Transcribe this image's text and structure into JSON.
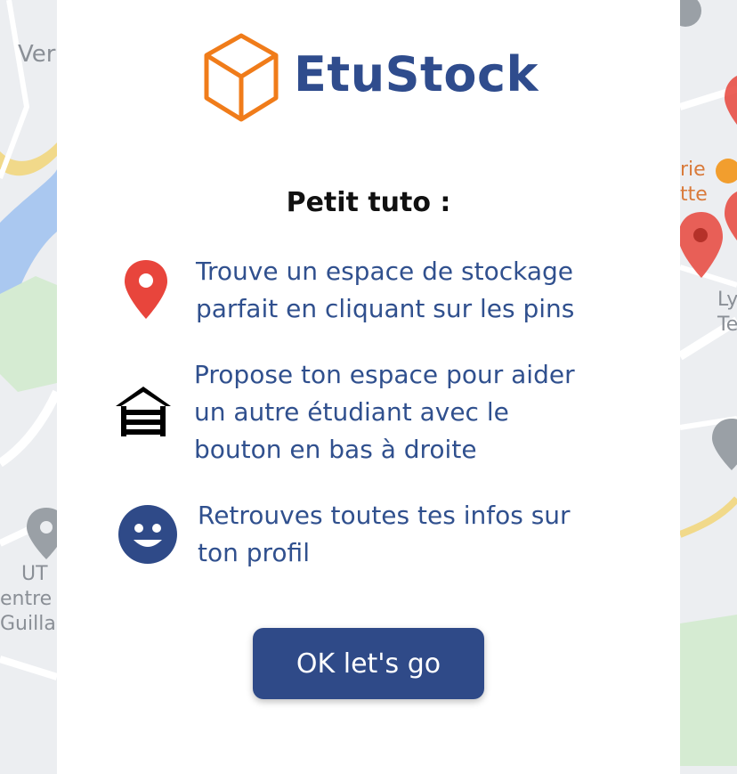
{
  "app": {
    "brand_name": "EtuStock",
    "brand_color": "#2f4c8d",
    "logo_color": "#f07c1a"
  },
  "tutorial": {
    "title": "Petit tuto :",
    "steps": [
      {
        "icon": "location-pin-icon",
        "icon_color": "#e8453c",
        "line1": "Trouve un espace de stockage",
        "line2": "parfait en cliquant sur les pins"
      },
      {
        "icon": "garage-house-icon",
        "icon_color": "#000000",
        "line1": "Propose ton espace pour aider",
        "line2": "un autre étudiant avec le",
        "line3": "bouton en bas à droite"
      },
      {
        "icon": "smiley-face-icon",
        "icon_color": "#2f4a88",
        "line1": "Retrouves toutes tes infos sur",
        "line2": "ton profil"
      }
    ],
    "button_label": "OK let's go",
    "button_color": "#2f4a88"
  },
  "map": {
    "labels": {
      "top_left": "Ver",
      "right_1": "rie",
      "right_2": "tte",
      "right_3": "Ly",
      "right_4": "Te",
      "left_1": "UT",
      "left_2": "entre",
      "left_3": "Guillau"
    }
  }
}
